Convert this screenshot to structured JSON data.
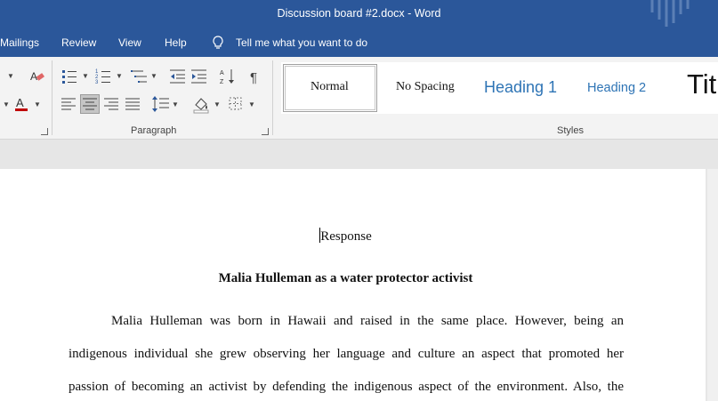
{
  "window": {
    "title": "Discussion board #2.docx  -  Word"
  },
  "menu": {
    "items": [
      "Mailings",
      "Review",
      "View",
      "Help"
    ],
    "tell_me": "Tell me what you want to do"
  },
  "ribbon": {
    "paragraph_label": "Paragraph",
    "styles_label": "Styles",
    "styles": [
      {
        "label": "Normal"
      },
      {
        "label": "No Spacing"
      },
      {
        "label": "Heading 1"
      },
      {
        "label": "Heading 2"
      },
      {
        "label": "Tit"
      }
    ]
  },
  "document": {
    "heading": "Response",
    "title": "Malia Hulleman as a water protector activist",
    "paragraph_lines": [
      "Malia Hulleman was born in Hawaii and raised in the same place. However, being an",
      "indigenous individual she grew observing her language and culture an aspect that promoted her",
      "passion of becoming an activist by defending the indigenous aspect of the environment. Also, the"
    ]
  },
  "colors": {
    "ribbon_blue": "#2b579a",
    "heading_blue": "#2e74b5",
    "font_red": "#c00000"
  }
}
